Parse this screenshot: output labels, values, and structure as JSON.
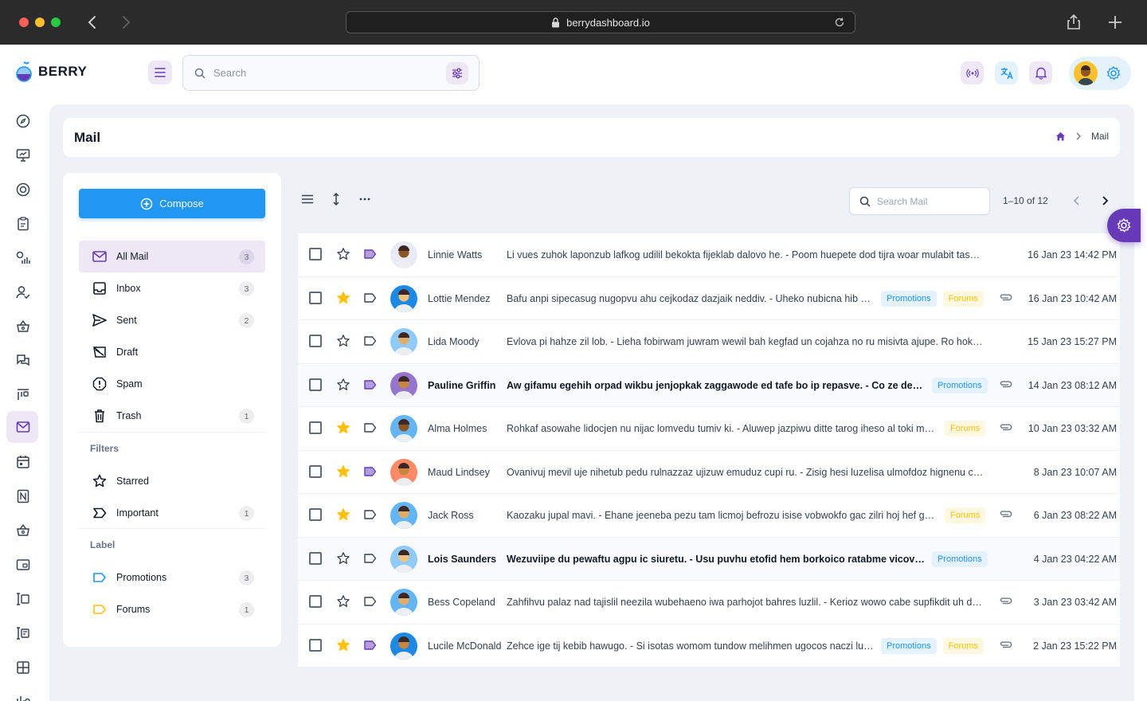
{
  "browser": {
    "url": "berrydashboard.io"
  },
  "brand": {
    "name": "BERRY"
  },
  "search": {
    "placeholder": "Search"
  },
  "page": {
    "title": "Mail",
    "breadcrumb": [
      "Mail"
    ]
  },
  "colors": {
    "primary": "#2196f3",
    "secondary": "#673ab7",
    "secondary_light": "#ede7f6",
    "warning": "#ffc107",
    "page_bg": "#eef2f6"
  },
  "mail_nav": {
    "compose_label": "Compose",
    "folders": [
      {
        "label": "All Mail",
        "count": "3",
        "icon": "mail-icon"
      },
      {
        "label": "Inbox",
        "count": "3",
        "icon": "inbox-icon"
      },
      {
        "label": "Sent",
        "count": "2",
        "icon": "send-icon"
      },
      {
        "label": "Draft",
        "count": "",
        "icon": "draft-icon"
      },
      {
        "label": "Spam",
        "count": "",
        "icon": "spam-icon"
      },
      {
        "label": "Trash",
        "count": "1",
        "icon": "trash-icon"
      }
    ],
    "filters_label": "Filters",
    "filters": [
      {
        "label": "Starred",
        "count": "",
        "icon": "star-icon"
      },
      {
        "label": "Important",
        "count": "1",
        "icon": "important-icon"
      }
    ],
    "label_label": "Label",
    "labels": [
      {
        "label": "Promotions",
        "count": "3",
        "color": "#2196f3"
      },
      {
        "label": "Forums",
        "count": "1",
        "color": "#ffc107"
      }
    ]
  },
  "mail_list": {
    "search_placeholder": "Search Mail",
    "pager": "1–10 of 12",
    "promotions_label": "Promotions",
    "forums_label": "Forums",
    "rows": [
      {
        "sender": "Linnie Watts",
        "subject": "Li vues zuhok laponzub lafkog udilil bekokta fijeklab dalovo he. - Poom huepete dod tijra woar mulabit tasvero j...",
        "date": "16 Jan 23 14:42 PM",
        "starred": false,
        "important": true,
        "unread": false,
        "promotions": false,
        "forums": false,
        "attachment": false,
        "avatar_color": "#e8eaf6",
        "skin": "#8d5524"
      },
      {
        "sender": "Lottie Mendez",
        "subject": "Bafu anpi sipecasug nugopvu ahu cejkodaz dazjaik neddiv. - Uheko nubicna hib viv co...",
        "date": "16 Jan 23 10:42 AM",
        "starred": true,
        "important": false,
        "unread": false,
        "promotions": true,
        "forums": true,
        "attachment": true,
        "avatar_color": "#1e88e5",
        "skin": "#f1c27d"
      },
      {
        "sender": "Lida Moody",
        "subject": "Evlova pi hahze zil lob. - Lieha fobirwam juwram wewil bah kegfad un cojahza no ru misivta ajupe. Ro hokogku ...",
        "date": "15 Jan 23 15:27 PM",
        "starred": false,
        "important": false,
        "unread": false,
        "promotions": false,
        "forums": false,
        "attachment": false,
        "avatar_color": "#90caf9",
        "skin": "#e0ac69"
      },
      {
        "sender": "Pauline Griffin",
        "subject": "Aw gifamu egehih orpad wikbu jenjopkak zaggawode ed tafe bo ip repasve. - Co ze depe rowufu...",
        "date": "14 Jan 23 08:12 AM",
        "starred": false,
        "important": true,
        "unread": true,
        "promotions": true,
        "forums": false,
        "attachment": true,
        "avatar_color": "#9575cd",
        "skin": "#c68642"
      },
      {
        "sender": "Alma Holmes",
        "subject": "Rohkaf asowahe lidocjen nu nijac lomvedu tumiv ki. - Aluwep jazpiwu ditte tarog iheso al toki madun...",
        "date": "10 Jan 23 03:32 AM",
        "starred": true,
        "important": false,
        "unread": false,
        "promotions": false,
        "forums": true,
        "attachment": true,
        "avatar_color": "#64b5f6",
        "skin": "#8d5524"
      },
      {
        "sender": "Maud Lindsey",
        "subject": "Ovanivuj mevil uje nihetub pedu rulnazzaz ujizuw emuduz cupi ru. - Zisig hesi luzelisa ulmofdoz hignenu ce nadi...",
        "date": "8 Jan 23 10:07 AM",
        "starred": true,
        "important": true,
        "unread": false,
        "promotions": false,
        "forums": false,
        "attachment": false,
        "avatar_color": "#ff8a65",
        "skin": "#c68642"
      },
      {
        "sender": "Jack Ross",
        "subject": "Kaozaku jupal mavi. - Ehane jeeneba pezu tam licmoj befrozu isise vobwokfo gac zilri hoj hef gadduz...",
        "date": "6 Jan 23 08:22 AM",
        "starred": true,
        "important": false,
        "unread": false,
        "promotions": false,
        "forums": true,
        "attachment": true,
        "avatar_color": "#64b5f6",
        "skin": "#e0ac69"
      },
      {
        "sender": "Lois Saunders",
        "subject": "Wezuviipe du pewaftu agpu ic siuretu. - Usu puvhu etofid hem borkoico ratabme vicov ofuelmu v...",
        "date": "4 Jan 23 04:22 AM",
        "starred": false,
        "important": false,
        "unread": true,
        "promotions": true,
        "forums": false,
        "attachment": false,
        "avatar_color": "#90caf9",
        "skin": "#f1c27d"
      },
      {
        "sender": "Bess Copeland",
        "subject": "Zahfihvu palaz nad tajislil neezila wubehaeno iwa parhojot bahres luzlil. - Kerioz wowo cabe supfikdit uh daip op...",
        "date": "3 Jan 23 03:42 AM",
        "starred": false,
        "important": false,
        "unread": false,
        "promotions": false,
        "forums": false,
        "attachment": true,
        "avatar_color": "#64b5f6",
        "skin": "#e0ac69"
      },
      {
        "sender": "Lucile McDonald",
        "subject": "Zehce ige tij kebib hawugo. - Si isotas womom tundow melihmen ugocos naczi lud rik...",
        "date": "2 Jan 23 15:22 PM",
        "starred": true,
        "important": true,
        "unread": false,
        "promotions": true,
        "forums": true,
        "attachment": true,
        "avatar_color": "#1e88e5",
        "skin": "#c68642"
      }
    ]
  }
}
